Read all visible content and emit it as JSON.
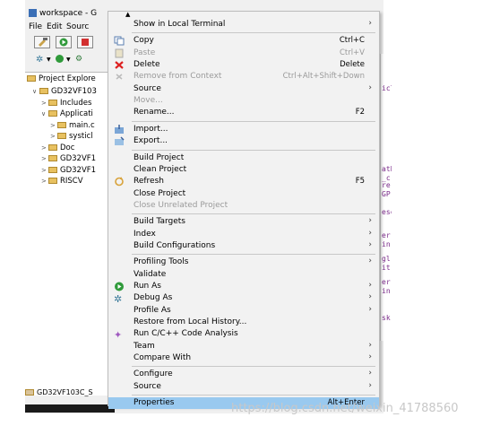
{
  "ide": {
    "window_title": "workspace - G",
    "menubar": [
      "File",
      "Edit",
      "Sourc"
    ],
    "explorer_tab": "Project Explore",
    "tree": [
      {
        "label": "GD32VF103",
        "arrow": "∨"
      },
      {
        "label": "Includes",
        "arrow": ">"
      },
      {
        "label": "Applicati",
        "arrow": "∨"
      },
      {
        "label": "main.c",
        "arrow": ">"
      },
      {
        "label": "systicl",
        "arrow": ">"
      },
      {
        "label": "Doc",
        "arrow": ">"
      },
      {
        "label": "GD32VF1",
        "arrow": ">"
      },
      {
        "label": "GD32VF1",
        "arrow": ">"
      },
      {
        "label": "RISCV",
        "arrow": ">"
      }
    ],
    "bottom_item": "GD32VF103C_S",
    "editor_fragments": [
      "iclu",
      "athe",
      "_c",
      "re",
      "GP",
      "esc",
      "er",
      "in",
      "gl",
      "it",
      "er",
      "in",
      "sk"
    ]
  },
  "menu": {
    "scroll_up_glyph": "▲",
    "items": [
      {
        "label": "Show in Local Terminal",
        "shortcut": "",
        "submenu": true,
        "disabled": false,
        "icon": ""
      },
      {
        "sep": true
      },
      {
        "label": "Copy",
        "shortcut": "Ctrl+C",
        "submenu": false,
        "disabled": false,
        "icon": "copy-icon"
      },
      {
        "label": "Paste",
        "shortcut": "Ctrl+V",
        "submenu": false,
        "disabled": true,
        "icon": "paste-icon"
      },
      {
        "label": "Delete",
        "shortcut": "Delete",
        "submenu": false,
        "disabled": false,
        "icon": "delete-icon"
      },
      {
        "label": "Remove from Context",
        "shortcut": "Ctrl+Alt+Shift+Down",
        "submenu": false,
        "disabled": true,
        "icon": "remove-context-icon"
      },
      {
        "label": "Source",
        "shortcut": "",
        "submenu": true,
        "disabled": false,
        "icon": ""
      },
      {
        "label": "Move...",
        "shortcut": "",
        "submenu": false,
        "disabled": true,
        "icon": ""
      },
      {
        "label": "Rename...",
        "shortcut": "F2",
        "submenu": false,
        "disabled": false,
        "icon": ""
      },
      {
        "sep": true
      },
      {
        "label": "Import...",
        "shortcut": "",
        "submenu": false,
        "disabled": false,
        "icon": "import-icon"
      },
      {
        "label": "Export...",
        "shortcut": "",
        "submenu": false,
        "disabled": false,
        "icon": "export-icon"
      },
      {
        "sep": true
      },
      {
        "label": "Build Project",
        "shortcut": "",
        "submenu": false,
        "disabled": false,
        "icon": ""
      },
      {
        "label": "Clean Project",
        "shortcut": "",
        "submenu": false,
        "disabled": false,
        "icon": ""
      },
      {
        "label": "Refresh",
        "shortcut": "F5",
        "submenu": false,
        "disabled": false,
        "icon": "refresh-icon"
      },
      {
        "label": "Close Project",
        "shortcut": "",
        "submenu": false,
        "disabled": false,
        "icon": ""
      },
      {
        "label": "Close Unrelated Project",
        "shortcut": "",
        "submenu": false,
        "disabled": true,
        "icon": ""
      },
      {
        "sep": true
      },
      {
        "label": "Build Targets",
        "shortcut": "",
        "submenu": true,
        "disabled": false,
        "icon": ""
      },
      {
        "label": "Index",
        "shortcut": "",
        "submenu": true,
        "disabled": false,
        "icon": ""
      },
      {
        "label": "Build Configurations",
        "shortcut": "",
        "submenu": true,
        "disabled": false,
        "icon": ""
      },
      {
        "sep": true
      },
      {
        "label": "Profiling Tools",
        "shortcut": "",
        "submenu": true,
        "disabled": false,
        "icon": ""
      },
      {
        "label": "Validate",
        "shortcut": "",
        "submenu": false,
        "disabled": false,
        "icon": ""
      },
      {
        "label": "Run As",
        "shortcut": "",
        "submenu": true,
        "disabled": false,
        "icon": "run-icon"
      },
      {
        "label": "Debug As",
        "shortcut": "",
        "submenu": true,
        "disabled": false,
        "icon": "debug-icon"
      },
      {
        "label": "Profile As",
        "shortcut": "",
        "submenu": true,
        "disabled": false,
        "icon": ""
      },
      {
        "label": "Restore from Local History...",
        "shortcut": "",
        "submenu": false,
        "disabled": false,
        "icon": ""
      },
      {
        "label": "Run C/C++ Code Analysis",
        "shortcut": "",
        "submenu": false,
        "disabled": false,
        "icon": "code-analysis-icon"
      },
      {
        "label": "Team",
        "shortcut": "",
        "submenu": true,
        "disabled": false,
        "icon": ""
      },
      {
        "label": "Compare With",
        "shortcut": "",
        "submenu": true,
        "disabled": false,
        "icon": ""
      },
      {
        "sep": true
      },
      {
        "label": "Configure",
        "shortcut": "",
        "submenu": true,
        "disabled": false,
        "icon": ""
      },
      {
        "label": "Source",
        "shortcut": "",
        "submenu": true,
        "disabled": false,
        "icon": ""
      },
      {
        "sep": true
      },
      {
        "label": "Properties",
        "shortcut": "Alt+Enter",
        "submenu": false,
        "disabled": false,
        "icon": "",
        "selected": true
      }
    ]
  },
  "watermark": "https://blog.csdn.net/weixin_41788560",
  "colors": {
    "selected": "#99c9ef",
    "disabled": "#9a9a9a"
  }
}
